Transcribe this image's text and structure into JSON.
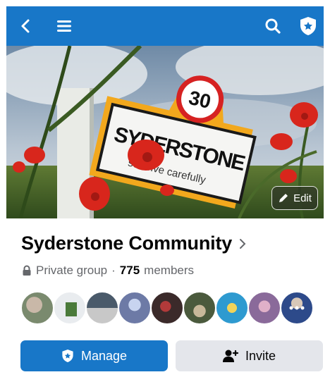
{
  "topbar": {
    "back_icon": "chevron-left-icon",
    "menu_icon": "hamburger-menu-icon",
    "search_icon": "search-icon",
    "admin_icon": "shield-star-icon",
    "color": "#1877c8"
  },
  "cover": {
    "sign_number": "30",
    "sign_town": "SYDERSTONE",
    "sign_subtext": "se drive carefully",
    "edit_label": "Edit",
    "edit_icon": "pencil-icon"
  },
  "group": {
    "name": "Syderstone Community",
    "chevron": "›",
    "privacy": "Private group",
    "separator": "·",
    "member_count": "775",
    "members_label": "members",
    "lock_icon": "lock-icon"
  },
  "avatars": {
    "count_shown": 9,
    "more_icon": "ellipsis-icon",
    "colors": [
      "#7a8a6e",
      "#e9ecef",
      "#4a5a6a",
      "#6d7aa6",
      "#3b2a2a",
      "#4b5a3d",
      "#2e9ad0",
      "#8a6a9a",
      "#2d4a8a"
    ]
  },
  "actions": {
    "manage_label": "Manage",
    "manage_icon": "shield-star-icon",
    "invite_label": "Invite",
    "invite_icon": "add-person-icon"
  }
}
